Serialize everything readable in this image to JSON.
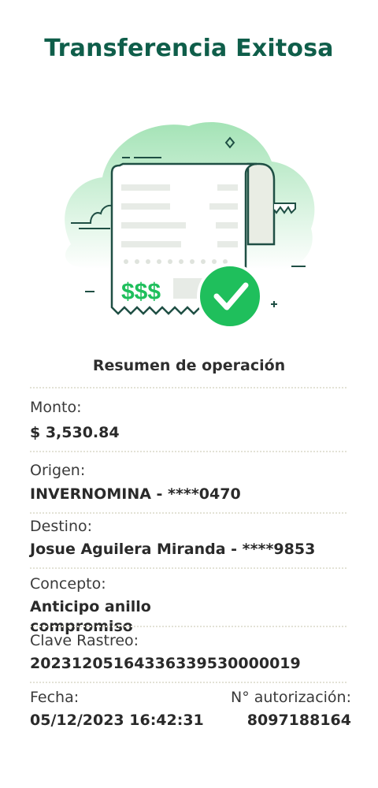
{
  "header": {
    "title": "Transferencia Exitosa"
  },
  "illustration": {
    "receipt_amount": "$$$"
  },
  "summary": {
    "title": "Resumen de operación",
    "monto": {
      "label": "Monto:",
      "value": "$ 3,530.84"
    },
    "origen": {
      "label": "Origen:",
      "value": "INVERNOMINA - ****0470"
    },
    "destino": {
      "label": "Destino:",
      "value": "Josue Aguilera Miranda - ****9853"
    },
    "concepto": {
      "label": "Concepto:",
      "value": "Anticipo anillo compromiso"
    },
    "clave": {
      "label": "Clave Rastreo:",
      "value": "20231205164336339530000019"
    },
    "fecha": {
      "label": "Fecha:",
      "value": "05/12/2023 16:42:31"
    },
    "autorizacion": {
      "label": "N° autorización:",
      "value": "8097188164"
    }
  },
  "colors": {
    "brand": "#0f5e4a",
    "success": "#1fbf5c",
    "cloud": "#9fe0b4",
    "divider": "#e3e2d6"
  }
}
